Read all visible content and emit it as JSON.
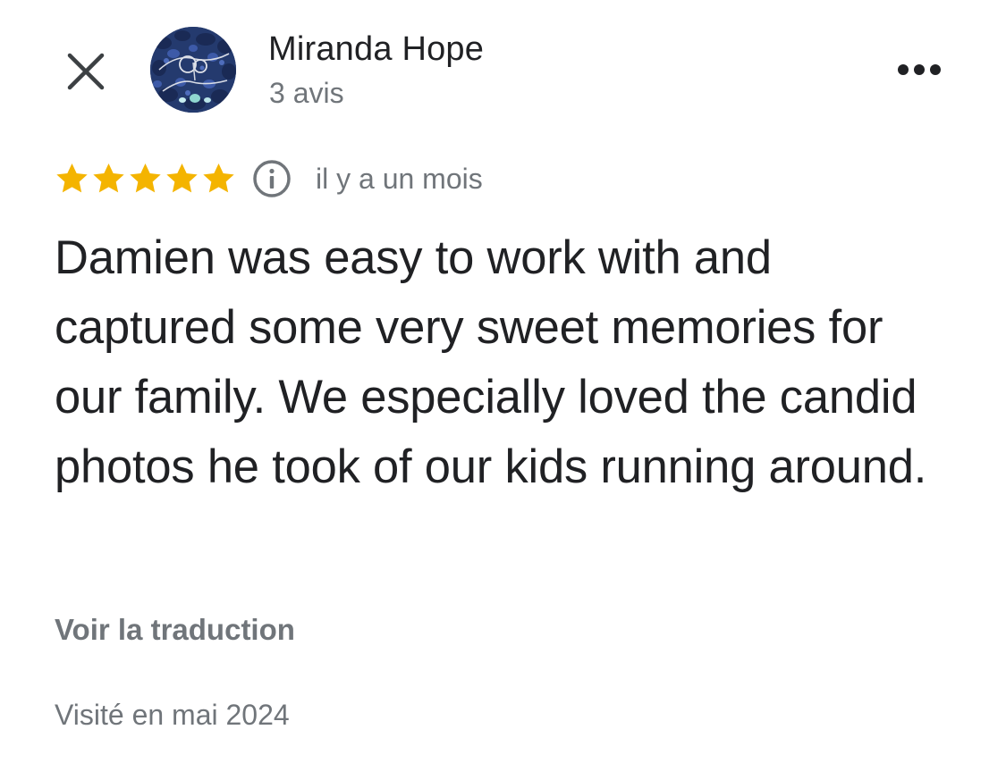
{
  "header": {
    "author_name": "Miranda Hope",
    "review_count": "3 avis"
  },
  "icons": {
    "close": "close-icon",
    "more": "more-horiz-icon",
    "info": "info-icon",
    "star": "star-icon"
  },
  "rating": {
    "stars": 5,
    "max_stars": 5,
    "star_color": "#f4b400",
    "time_ago": "il y a un mois"
  },
  "review": {
    "text": "Damien was easy to work with and captured some very sweet memories for our family. We especially loved the candid photos he took of our kids running around.",
    "translate_label": "Voir la traduction",
    "visited": "Visité en mai 2024"
  },
  "colors": {
    "primary_text": "#202124",
    "secondary_text": "#70757a"
  }
}
